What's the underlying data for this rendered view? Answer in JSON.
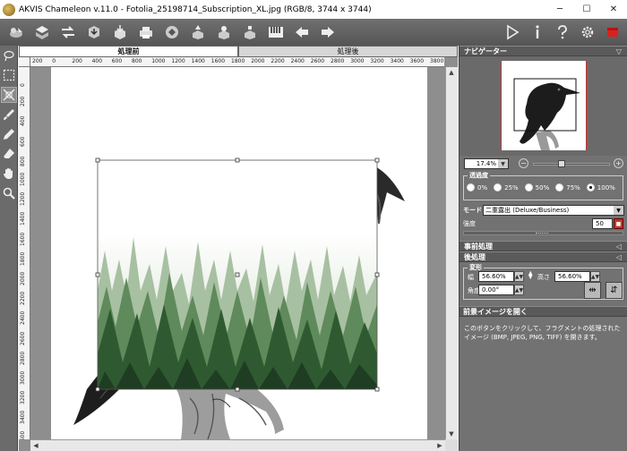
{
  "window": {
    "title": "AKVIS Chameleon v.11.0 - Fotolia_25198714_Subscription_XL.jpg (RGB/8, 3744 x 3744)",
    "minimize": "─",
    "maximize": "☐",
    "close": "✕"
  },
  "toolbar": {
    "left_icons": [
      "open-image-icon",
      "copy-layers-icon",
      "swap-icon",
      "export-icon",
      "save-icon",
      "print-icon",
      "share-icon",
      "fragment-icon",
      "batch-icon",
      "fill-icon",
      "piano-icon",
      "back-arrow-icon",
      "forward-arrow-icon"
    ],
    "right_icons": [
      "run-icon",
      "info-icon",
      "help-icon",
      "settings-icon",
      "akvis-logo-icon"
    ]
  },
  "tools": [
    "lasso-icon",
    "rect-selection-icon",
    "transform-icon",
    "brush-icon",
    "pencil-icon",
    "eraser-icon",
    "hand-icon",
    "zoom-icon"
  ],
  "tabs": {
    "before": "処理前",
    "after": "処理後"
  },
  "ruler": {
    "h_labels": [
      "200",
      "0",
      "200",
      "400",
      "600",
      "800",
      "1000",
      "1200",
      "1400",
      "1600",
      "1800",
      "2000",
      "2200",
      "2400",
      "2600",
      "2800",
      "3000",
      "3200",
      "3400",
      "3600",
      "3800"
    ],
    "v_labels": [
      "0",
      "200",
      "400",
      "600",
      "800",
      "1000",
      "1200",
      "1400",
      "1600",
      "1800",
      "2000",
      "2200",
      "2400",
      "2600",
      "2800",
      "3000",
      "3200",
      "3400",
      "3600",
      "3800"
    ]
  },
  "navigator": {
    "header": "ナビゲーター",
    "zoom": "17.4%",
    "zoom_out": "−",
    "zoom_in": "+"
  },
  "opacity": {
    "title": "透過度",
    "options": [
      "0%",
      "25%",
      "50%",
      "75%",
      "100%"
    ],
    "selected": "100%"
  },
  "mode": {
    "label": "モード",
    "value": "二重露出 (Deluxe/Business)"
  },
  "strength": {
    "label": "強度",
    "value": "50"
  },
  "sections": {
    "preprocess": "事前処理",
    "postprocess": "後処理"
  },
  "transform": {
    "title": "変形",
    "width_label": "幅",
    "width_value": "56.60%",
    "height_label": "高さ",
    "height_value": "56.60%",
    "angle_label": "角度",
    "angle_value": "0.00°"
  },
  "help": {
    "title": "前景イメージを開く",
    "text": "このボタンをクリックして、フラグメントの処理されたイメージ (BMP, JPEG, PNG, TIFF) を開きます。"
  }
}
